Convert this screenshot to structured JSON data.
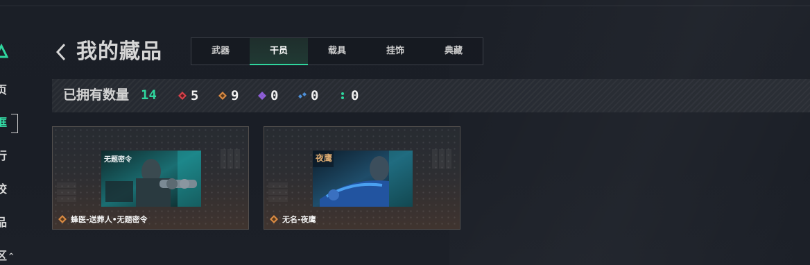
{
  "sidebar": {
    "items": [
      {
        "label": "页",
        "active": false
      },
      {
        "label": "框",
        "active": true
      },
      {
        "label": "行",
        "active": false
      },
      {
        "label": "校",
        "active": false
      },
      {
        "label": "品",
        "active": false
      },
      {
        "label": "区",
        "active": false
      }
    ],
    "accent": "#2fd69e"
  },
  "header": {
    "title": "我的藏品",
    "tabs": [
      {
        "label": "武器",
        "active": false
      },
      {
        "label": "干员",
        "active": true
      },
      {
        "label": "载具",
        "active": false
      },
      {
        "label": "挂饰",
        "active": false
      },
      {
        "label": "典藏",
        "active": false
      }
    ]
  },
  "stats": {
    "label": "已拥有数量",
    "total": "14",
    "rarities": [
      {
        "icon": "red-diamond-icon",
        "color": "#d9414a",
        "count": "5"
      },
      {
        "icon": "orange-diamond-icon",
        "color": "#d98a43",
        "count": "9"
      },
      {
        "icon": "purple-diamond-cluster-icon",
        "color": "#8e5ed8",
        "count": "0"
      },
      {
        "icon": "blue-diamond-pair-icon",
        "color": "#4d8fd8",
        "count": "0"
      },
      {
        "icon": "green-dots-icon",
        "color": "#2fd69e",
        "count": "0"
      }
    ]
  },
  "cards": [
    {
      "name": "蜂医-送葬人•无题密令",
      "art_label": "无题密令",
      "rarity_color": "#d98a43"
    },
    {
      "name": "无名-夜鹰",
      "art_label": "夜鹰",
      "rarity_color": "#d98a43"
    }
  ]
}
